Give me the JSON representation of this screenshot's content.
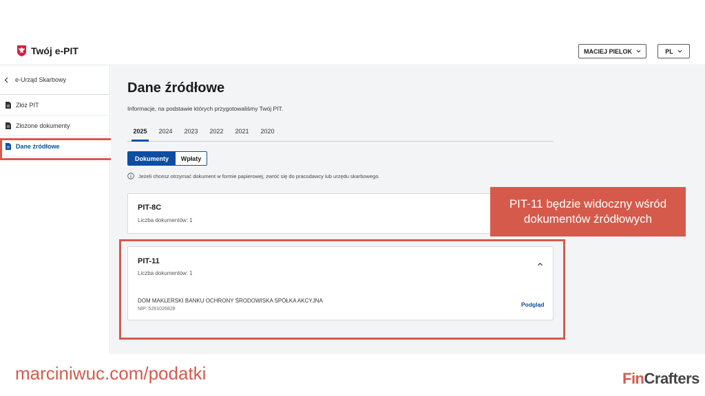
{
  "header": {
    "app_name": "Twój e-PIT",
    "user_label": "MACIEJ PIELOK",
    "lang_label": "PL"
  },
  "sidebar": {
    "back_label": "e-Urząd Skarbowy",
    "items": [
      {
        "label": "Złóż PIT"
      },
      {
        "label": "Złożone dokumenty"
      },
      {
        "label": "Dane źródłowe"
      }
    ]
  },
  "main": {
    "title": "Dane źródłowe",
    "description": "Informacje, na podstawie których przygotowaliśmy Twój PIT.",
    "year_tabs": [
      "2025",
      "2024",
      "2023",
      "2022",
      "2021",
      "2020"
    ],
    "active_year": "2025",
    "segments": [
      "Dokumenty",
      "Wpłaty"
    ],
    "info_text": "Jeżeli chcesz otrzymać dokument w formie papierowej, zwróć się do pracodawcy lub urzędu skarbowego.",
    "cards": [
      {
        "title": "PIT-8C",
        "count_label": "Liczba dokumentów: 1"
      },
      {
        "title": "PIT-11",
        "count_label": "Liczba dokumentów: 1",
        "entity": "DOM MAKLERSKI BANKU OCHRONY ŚRODOWISKA SPÓŁKA AKCYJNA",
        "nip": "NIP: 5261026828",
        "preview_label": "Podgląd"
      }
    ]
  },
  "overlay": {
    "callout": "PIT-11 będzie widoczny wśród dokumentów źródłowych",
    "footer_link": "marciniwuc.com/podatki",
    "brand_part1": "Fin",
    "brand_part2": "Crafters",
    "highlight_color": "#d65a4b"
  },
  "colors": {
    "accent": "#0b4ea2",
    "background": "#f3f4f6"
  }
}
